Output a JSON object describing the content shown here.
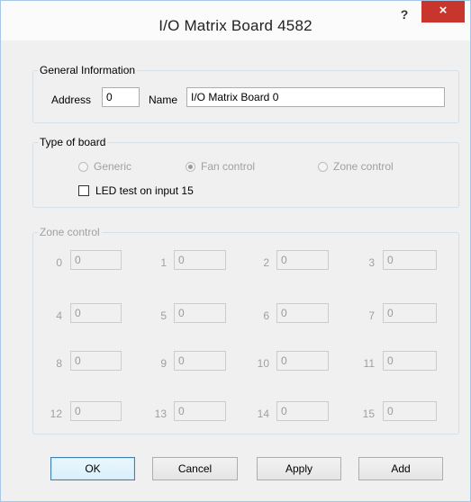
{
  "window": {
    "title": "I/O Matrix Board 4582",
    "help_label": "?",
    "close_label": "×"
  },
  "general": {
    "legend": "General Information",
    "address_label": "Address",
    "address_value": "0",
    "name_label": "Name",
    "name_value": "I/O Matrix Board 0"
  },
  "board_type": {
    "legend": "Type of board",
    "options": [
      {
        "label": "Generic",
        "checked": false
      },
      {
        "label": "Fan control",
        "checked": true
      },
      {
        "label": "Zone control",
        "checked": false
      }
    ],
    "led_test_label": "LED test on input 15",
    "led_test_checked": false
  },
  "zone_control": {
    "legend": "Zone control",
    "zones": [
      {
        "number": "0",
        "value": "0"
      },
      {
        "number": "1",
        "value": "0"
      },
      {
        "number": "2",
        "value": "0"
      },
      {
        "number": "3",
        "value": "0"
      },
      {
        "number": "4",
        "value": "0"
      },
      {
        "number": "5",
        "value": "0"
      },
      {
        "number": "6",
        "value": "0"
      },
      {
        "number": "7",
        "value": "0"
      },
      {
        "number": "8",
        "value": "0"
      },
      {
        "number": "9",
        "value": "0"
      },
      {
        "number": "10",
        "value": "0"
      },
      {
        "number": "11",
        "value": "0"
      },
      {
        "number": "12",
        "value": "0"
      },
      {
        "number": "13",
        "value": "0"
      },
      {
        "number": "14",
        "value": "0"
      },
      {
        "number": "15",
        "value": "0"
      }
    ]
  },
  "buttons": {
    "ok": "OK",
    "cancel": "Cancel",
    "apply": "Apply",
    "add": "Add"
  }
}
